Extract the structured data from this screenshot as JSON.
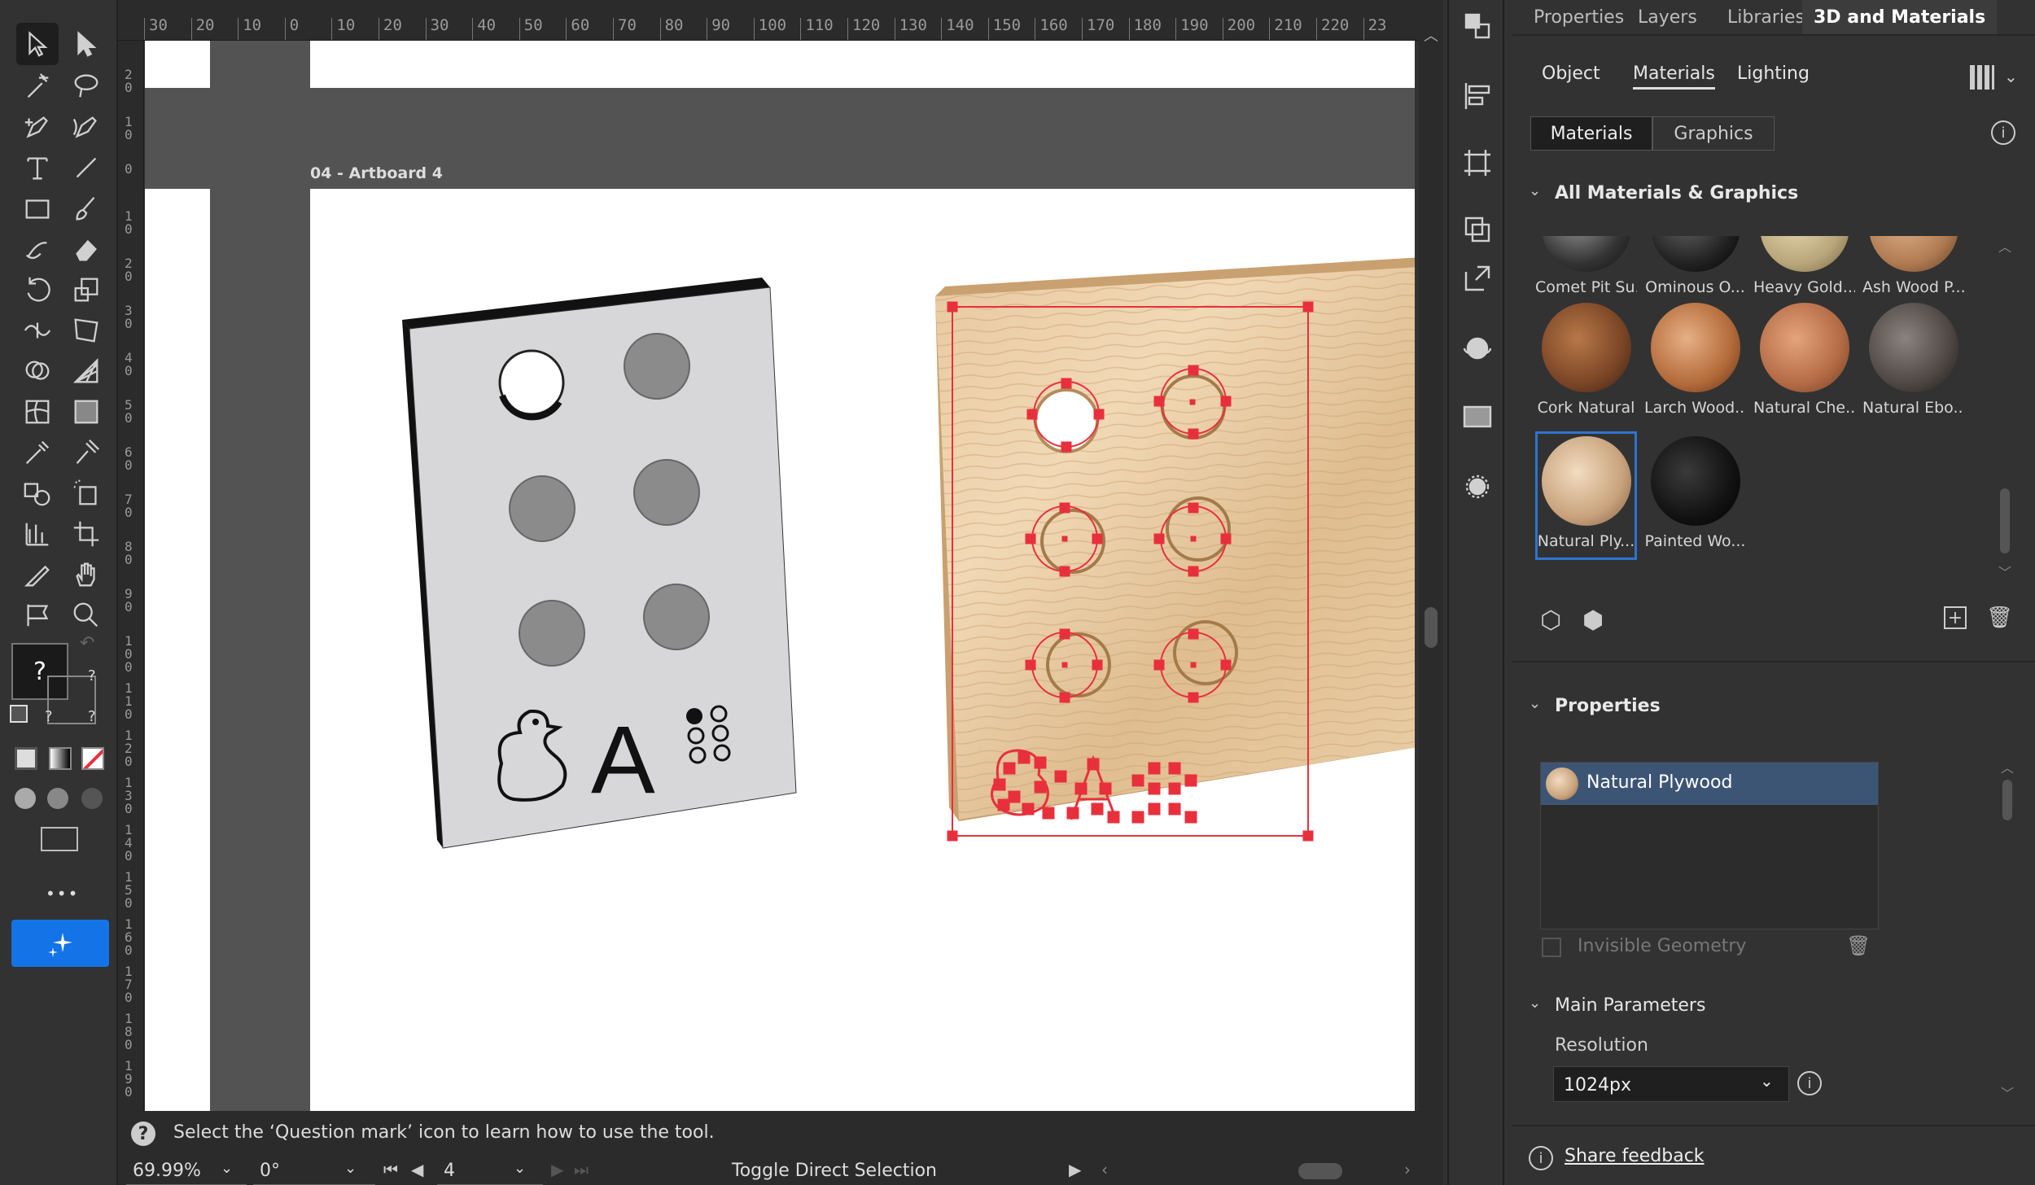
{
  "panel": {
    "tabs": [
      "Properties",
      "Layers",
      "Libraries",
      "3D and Materials"
    ],
    "subtabs": [
      "Object",
      "Materials",
      "Lighting"
    ],
    "toggle": [
      "Materials",
      "Graphics"
    ],
    "all_materials_header": "All Materials & Graphics",
    "swatches_row0": [
      "Comet Pit Su...",
      "Ominous O...",
      "Heavy Gold...",
      "Ash Wood P..."
    ],
    "swatches_row1": [
      "Cork Natural",
      "Larch Wood...",
      "Natural Che...",
      "Natural Ebo..."
    ],
    "swatches_row2": [
      "Natural Ply...",
      "Painted Wo..."
    ],
    "properties_header": "Properties",
    "selected_material": "Natural Plywood",
    "invisible_geometry": "Invisible Geometry",
    "main_params_header": "Main Parameters",
    "resolution_label": "Resolution",
    "resolution_value": "1024px",
    "share_feedback": "Share feedback"
  },
  "canvas": {
    "artboard_label": "04 - Artboard 4",
    "braille_letter": "A"
  },
  "status": {
    "hint": "Select the ‘Question mark’ icon to learn how to use the tool.",
    "zoom": "69.99%",
    "rotation": "0°",
    "artboard_num": "4",
    "toggle_label": "Toggle Direct Selection"
  },
  "ruler": {
    "h_ticks": [
      "30",
      "20",
      "10",
      "0",
      "10",
      "20",
      "30",
      "40",
      "50",
      "60",
      "70",
      "80",
      "90",
      "100",
      "110",
      "120",
      "130",
      "140",
      "150",
      "160",
      "170",
      "180",
      "190",
      "200",
      "210",
      "220",
      "23"
    ],
    "v_ticks": [
      "20",
      "10",
      "0",
      "10",
      "20",
      "30",
      "40",
      "50",
      "60",
      "70",
      "80",
      "90",
      "100",
      "110",
      "120",
      "130",
      "140",
      "150",
      "160",
      "170",
      "180",
      "190"
    ]
  },
  "toolbar": {
    "question_mark": "?",
    "more": "•••"
  },
  "colors": {
    "accent": "#1473e6",
    "selection": "#e8303c",
    "panel_bg": "#323232",
    "highlight_row": "#3d5575"
  }
}
